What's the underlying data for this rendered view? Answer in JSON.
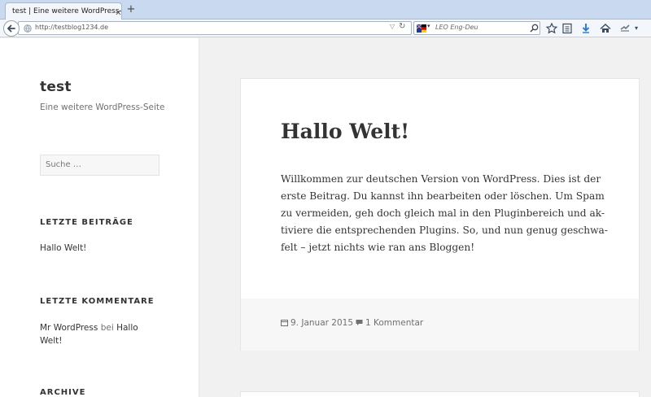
{
  "browser": {
    "tab_title": "test | Eine weitere WordPress-S...",
    "tab_close": "✕",
    "new_tab": "+",
    "url": "http://testblog1234.de",
    "search_placeholder": "LEO Eng-Deu"
  },
  "site": {
    "title": "test",
    "description": "Eine weitere WordPress-Seite"
  },
  "sidebar": {
    "search_placeholder": "Suche …",
    "recent_posts_title": "LETZTE BEITRÄGE",
    "recent_posts": [
      "Hallo Welt!"
    ],
    "recent_comments_title": "LETZTE KOMMENTARE",
    "recent_comment": {
      "author": "Mr WordPress",
      "connector": "bei",
      "post": "Hallo Welt!"
    },
    "archive_title": "ARCHIVE"
  },
  "post": {
    "title": "Hallo Welt!",
    "body_lines": [
      "Willkommen zur deutschen Version von WordPress. Dies ist der",
      "erste Beitrag. Du kannst ihn bearbeiten oder löschen. Um Spam",
      "zu vermeiden, geh doch gleich mal in den Pluginbereich und ak-",
      "tiviere die entsprechenden Plugins. So, und nun genug geschwa-",
      "felt – jetzt nichts wie ran ans Bloggen!"
    ],
    "date": "9. Januar 2015",
    "comments": "1 Kommentar"
  },
  "colors": {
    "accent": "#c9daf0",
    "text": "#333333",
    "muted": "#707070"
  }
}
